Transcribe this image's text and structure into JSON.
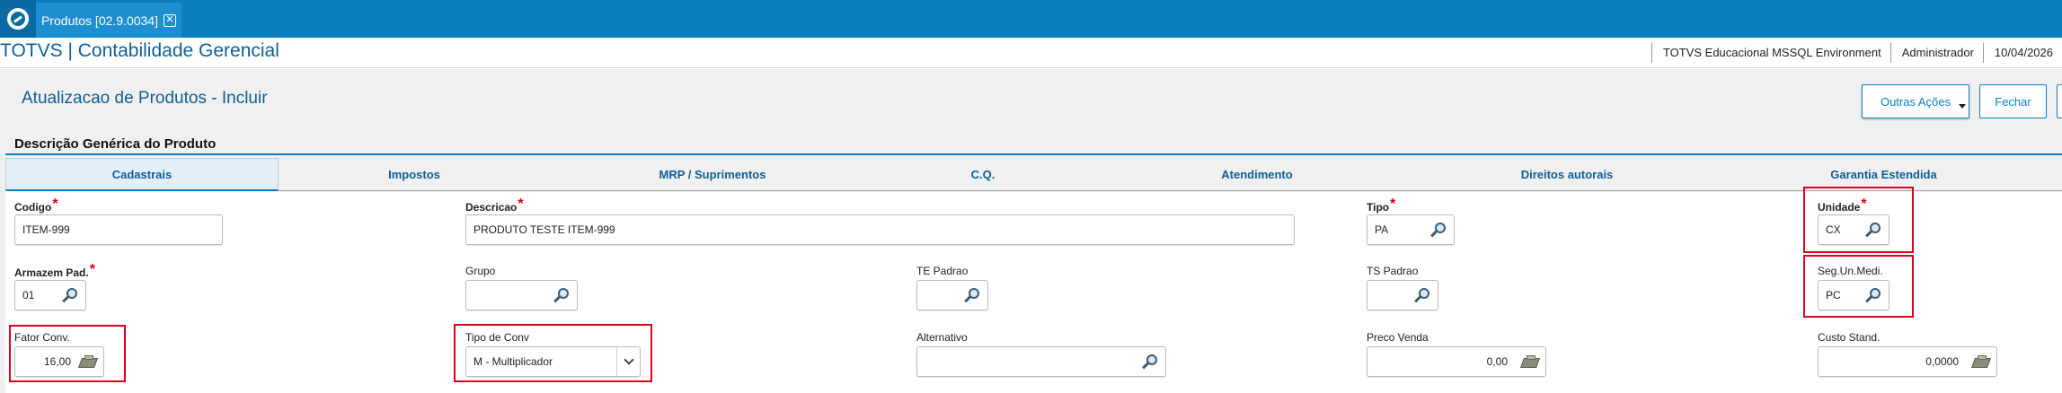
{
  "window_tab": {
    "label": "Produtos [02.9.0034]",
    "close_glyph": "✕"
  },
  "header": {
    "app_title": "TOTVS | Contabilidade Gerencial",
    "environment": "TOTVS Educacional MSSQL Environment",
    "user": "Administrador",
    "date": "10/04/2026"
  },
  "page": {
    "title": "Atualizacao de Produtos - Incluir",
    "buttons": {
      "outras_acoes": "Outras Ações",
      "fechar": "Fechar"
    },
    "section_label": "Descrição Genérica do Produto"
  },
  "tabs": [
    "Cadastrais",
    "Impostos",
    "MRP / Suprimentos",
    "C.Q.",
    "Atendimento",
    "Direitos autorais",
    "Garantia Estendida"
  ],
  "selected_tab": "Cadastrais",
  "fields": {
    "codigo": {
      "label": "Codigo",
      "value": "ITEM-999",
      "required": true
    },
    "descricao": {
      "label": "Descricao",
      "value": "PRODUTO TESTE ITEM-999",
      "required": true
    },
    "tipo": {
      "label": "Tipo",
      "value": "PA",
      "required": true
    },
    "unidade": {
      "label": "Unidade",
      "value": "CX",
      "required": true
    },
    "armazem": {
      "label": "Armazem Pad.",
      "value": "01",
      "required": true
    },
    "grupo": {
      "label": "Grupo",
      "value": ""
    },
    "te_padrao": {
      "label": "TE Padrao",
      "value": ""
    },
    "ts_padrao": {
      "label": "TS Padrao",
      "value": ""
    },
    "seg_un_medi": {
      "label": "Seg.Un.Medi.",
      "value": "PC"
    },
    "fator_conv": {
      "label": "Fator Conv.",
      "value": "16,00"
    },
    "tipo_conv": {
      "label": "Tipo de Conv",
      "value": "M - Multiplicador"
    },
    "alternativo": {
      "label": "Alternativo",
      "value": ""
    },
    "preco_venda": {
      "label": "Preco Venda",
      "value": "0,00"
    },
    "custo_stand": {
      "label": "Custo Stand.",
      "value": "0,0000"
    }
  },
  "required_mark": "*",
  "colors": {
    "brand_blue": "#0b7ec1",
    "title_blue": "#0d5f96",
    "highlight_red": "#e0001a",
    "required_red": "#d4001a"
  },
  "icons": {
    "lookup": "magnifier-icon",
    "calculator": "calculator-icon",
    "dropdown": "chevron-down-icon",
    "logo": "totvs-logo-icon"
  }
}
